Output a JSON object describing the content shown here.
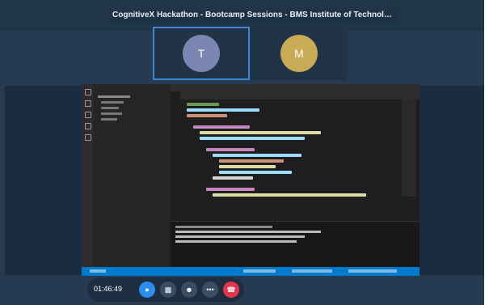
{
  "meeting": {
    "title": "CognitiveX Hackathon - Bootcamp Sessions - BMS Institute of Technology and Managem...",
    "timer": "01:46:49"
  },
  "participants": [
    {
      "initial": "T",
      "color": "#7b86b3",
      "active": true
    },
    {
      "initial": "M",
      "color": "#c9aa55",
      "active": false
    }
  ],
  "controls": {
    "chat_icon": "chat-icon",
    "reactions_icon": "chart-icon",
    "people_icon": "people-icon",
    "more_label": "•••",
    "end_icon": "end-call-icon",
    "end_color": "#e3364d",
    "accent": "#2d8cf0"
  }
}
